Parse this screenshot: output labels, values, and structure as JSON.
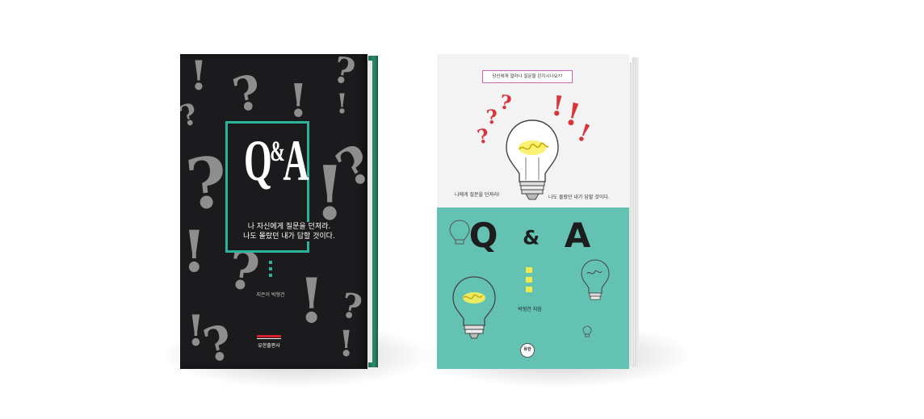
{
  "book1": {
    "title": "Q&A",
    "title_q": "Q",
    "title_amp": "&",
    "title_a": "A",
    "subtitle_line1": "나 자신에게 질문을 던져라.",
    "subtitle_line2": "나도 몰랐던 내가 답할 것이다.",
    "author": "지은이 박형건",
    "publisher": "유한출판사",
    "colors": {
      "cover": "#1b1b1d",
      "accent": "#2bb39a",
      "spine": "#2e8a6b",
      "glyph": "#9b9b9b"
    }
  },
  "book2": {
    "tagline": "당신에게 얼마나 질문을 던지시나요??",
    "left_quote": "나에게 질문을 던져라!",
    "right_quote": "나도 몰랐던 내가 답할 것이다.",
    "title_q": "Q",
    "title_amp": "&",
    "title_a": "A",
    "author": "박형건 지음",
    "publisher_logo": "유한",
    "colors": {
      "top": "#f3f3f3",
      "bottom": "#63c2b2",
      "accent_red": "#d9343b",
      "accent_yellow": "#f2e84d",
      "tag_border": "#c96ab0"
    }
  }
}
